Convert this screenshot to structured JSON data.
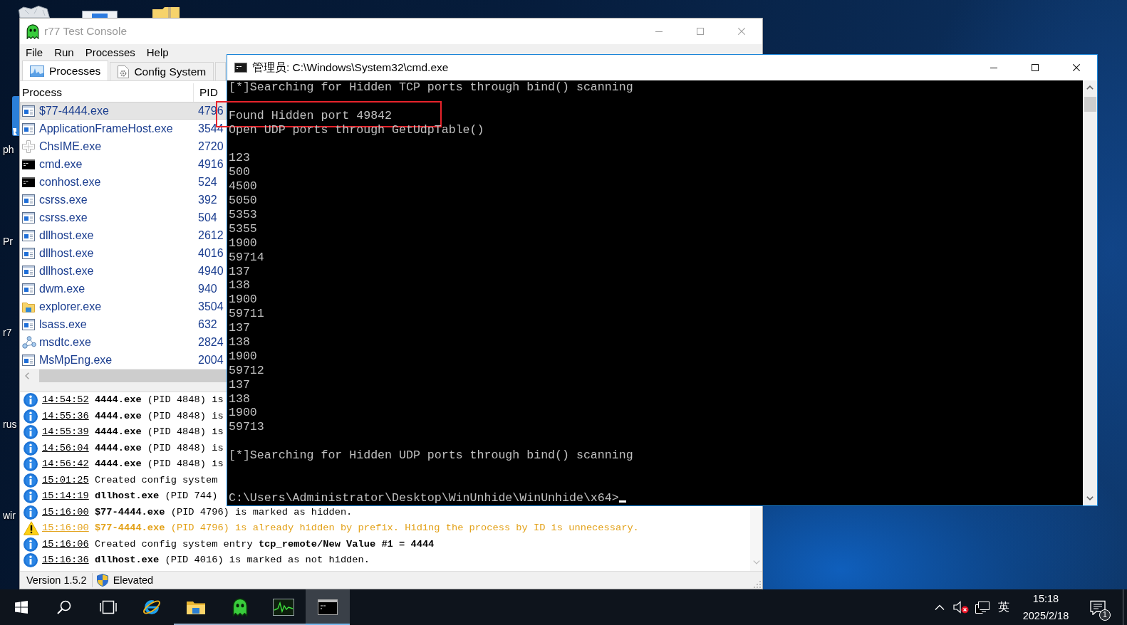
{
  "desktop": {
    "icon_labels": [
      "ph",
      "Pr",
      "r7",
      "rus",
      "wir"
    ]
  },
  "r77_window": {
    "title": "r77 Test Console",
    "focused": false,
    "menu": [
      "File",
      "Run",
      "Processes",
      "Help"
    ],
    "tabs": [
      {
        "label": "Processes",
        "kind": "chart",
        "selected": true
      },
      {
        "label": "Config System",
        "kind": "config",
        "selected": false
      },
      {
        "kind": "other",
        "selected": false
      }
    ],
    "process_table": {
      "columns": [
        "Process",
        "PID"
      ],
      "rows": [
        {
          "kind": "app",
          "name": "$77-4444.exe",
          "pid": "4796",
          "selected": true
        },
        {
          "kind": "app",
          "name": "ApplicationFrameHost.exe",
          "pid": "3544",
          "selected": false
        },
        {
          "kind": "ime",
          "name": "ChsIME.exe",
          "pid": "2720",
          "selected": false
        },
        {
          "kind": "console",
          "name": "cmd.exe",
          "pid": "4916",
          "selected": false
        },
        {
          "kind": "console",
          "name": "conhost.exe",
          "pid": "524",
          "selected": false
        },
        {
          "kind": "app",
          "name": "csrss.exe",
          "pid": "392",
          "selected": false
        },
        {
          "kind": "app",
          "name": "csrss.exe",
          "pid": "504",
          "selected": false
        },
        {
          "kind": "app",
          "name": "dllhost.exe",
          "pid": "2612",
          "selected": false
        },
        {
          "kind": "app",
          "name": "dllhost.exe",
          "pid": "4016",
          "selected": false
        },
        {
          "kind": "app",
          "name": "dllhost.exe",
          "pid": "4940",
          "selected": false
        },
        {
          "kind": "app",
          "name": "dwm.exe",
          "pid": "940",
          "selected": false
        },
        {
          "kind": "explorer",
          "name": "explorer.exe",
          "pid": "3504",
          "selected": false
        },
        {
          "kind": "app",
          "name": "lsass.exe",
          "pid": "632",
          "selected": false
        },
        {
          "kind": "service",
          "name": "msdtc.exe",
          "pid": "2824",
          "selected": false
        },
        {
          "kind": "app",
          "name": "MsMpEng.exe",
          "pid": "2004",
          "selected": false
        }
      ]
    },
    "log": [
      {
        "kind": "info",
        "time": "14:54:52",
        "text": "**4444.exe** (PID 4848) is"
      },
      {
        "kind": "info",
        "time": "14:55:36",
        "text": "**4444.exe** (PID 4848) is"
      },
      {
        "kind": "info",
        "time": "14:55:39",
        "text": "**4444.exe** (PID 4848) is"
      },
      {
        "kind": "info",
        "time": "14:56:04",
        "text": "**4444.exe** (PID 4848) is"
      },
      {
        "kind": "info",
        "time": "14:56:42",
        "text": "**4444.exe** (PID 4848) is"
      },
      {
        "kind": "info",
        "time": "15:01:25",
        "text": "Created config system"
      },
      {
        "kind": "info",
        "time": "15:14:19",
        "text": "**dllhost.exe** (PID 744)"
      },
      {
        "kind": "info",
        "time": "15:16:00",
        "text": "**$77-4444.exe** (PID 4796) is marked as hidden."
      },
      {
        "kind": "warning",
        "time": "15:16:00",
        "text": "**$77-4444.exe** (PID 4796) is already hidden by prefix. Hiding the process by ID is unnecessary."
      },
      {
        "kind": "info",
        "time": "15:16:06",
        "text": "Created config system entry **tcp_remote/New Value #1 = 4444**"
      },
      {
        "kind": "info",
        "time": "15:16:36",
        "text": "**dllhost.exe** (PID 4016) is marked as not hidden."
      }
    ],
    "status_bar": {
      "version": "Version 1.5.2",
      "elevation": "Elevated"
    }
  },
  "cmd_window": {
    "title": "管理员: C:\\Windows\\System32\\cmd.exe",
    "focused": true,
    "blocks": [
      [
        {
          "text": "[*]Searching for Hidden TCP ports through bind() scanning",
          "highlighted": false
        }
      ],
      [
        {
          "text": "Found Hidden port 49842",
          "highlighted": true
        },
        {
          "text": "Open UDP ports through GetUdpTable()",
          "highlighted": false
        }
      ],
      [
        {
          "text": "123",
          "highlighted": false
        },
        {
          "text": "500",
          "highlighted": false
        },
        {
          "text": "4500",
          "highlighted": false
        },
        {
          "text": "5050",
          "highlighted": false
        },
        {
          "text": "5353",
          "highlighted": false
        },
        {
          "text": "5355",
          "highlighted": false
        },
        {
          "text": "1900",
          "highlighted": false
        },
        {
          "text": "59714",
          "highlighted": false
        },
        {
          "text": "137",
          "highlighted": false
        },
        {
          "text": "138",
          "highlighted": false
        },
        {
          "text": "1900",
          "highlighted": false
        },
        {
          "text": "59711",
          "highlighted": false
        },
        {
          "text": "137",
          "highlighted": false
        },
        {
          "text": "138",
          "highlighted": false
        },
        {
          "text": "1900",
          "highlighted": false
        },
        {
          "text": "59712",
          "highlighted": false
        },
        {
          "text": "137",
          "highlighted": false
        },
        {
          "text": "138",
          "highlighted": false
        },
        {
          "text": "1900",
          "highlighted": false
        },
        {
          "text": "59713",
          "highlighted": false
        }
      ],
      [
        {
          "text": "[*]Searching for Hidden UDP ports through bind() scanning",
          "highlighted": false
        }
      ]
    ],
    "prompt": "C:\\Users\\Administrator\\Desktop\\WinUnhide\\WinUnhide\\x64>"
  },
  "taskbar": {
    "items": [
      {
        "kind": "start",
        "running": false,
        "active": false
      },
      {
        "kind": "search",
        "running": false,
        "active": false
      },
      {
        "kind": "taskview",
        "running": false,
        "active": false
      },
      {
        "kind": "browser",
        "running": false,
        "active": false
      },
      {
        "kind": "files",
        "running": true,
        "active": false
      },
      {
        "kind": "ghost",
        "running": true,
        "active": false
      },
      {
        "kind": "monitor",
        "running": true,
        "active": false
      },
      {
        "kind": "console",
        "running": true,
        "active": true
      }
    ],
    "tray": {
      "input_language": "英",
      "time": "15:18",
      "date": "2025/2/18",
      "notification_count": "1"
    }
  }
}
